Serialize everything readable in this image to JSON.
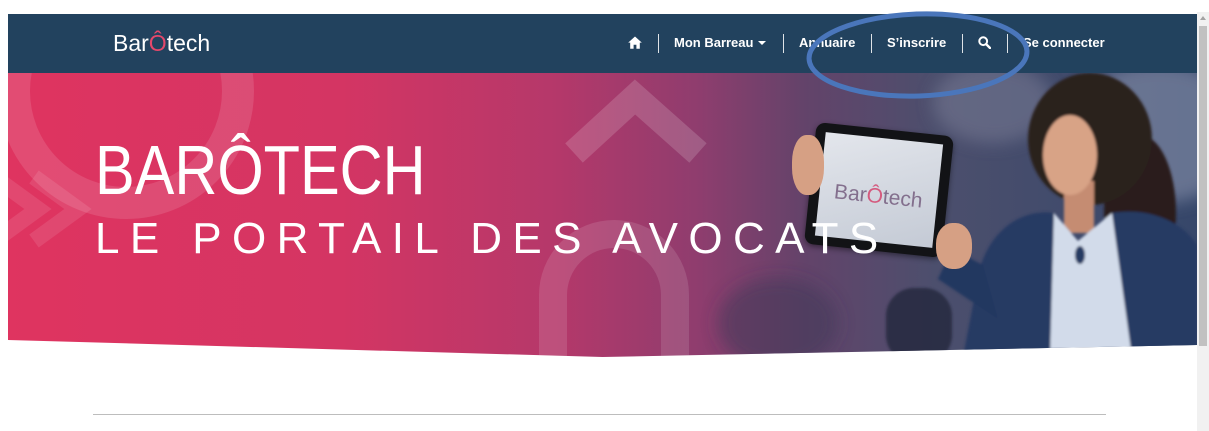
{
  "navbar": {
    "logo": {
      "prefix": "Bar",
      "accent": "Ô",
      "suffix": "tech"
    },
    "home_icon": "home-icon",
    "my_bar": {
      "label": "Mon Barreau",
      "icon": "caret-down-icon"
    },
    "directory_label": "Annuaire",
    "register_label": "S’inscrire",
    "search_icon": "search-icon",
    "login_label": "Se connecter"
  },
  "hero": {
    "title": "BARÔTECH",
    "subtitle": "LE PORTAIL DES AVOCATS",
    "tablet_logo": {
      "prefix": "Bar",
      "accent": "Ô",
      "suffix": "tech"
    }
  },
  "colors": {
    "navbar_bg": "#22425e",
    "logo_accent": "#e4486b",
    "hero_start": "#df3460",
    "hero_end": "#36476a",
    "annotation": "#4a76bb",
    "divider": "#bdbdbd"
  }
}
